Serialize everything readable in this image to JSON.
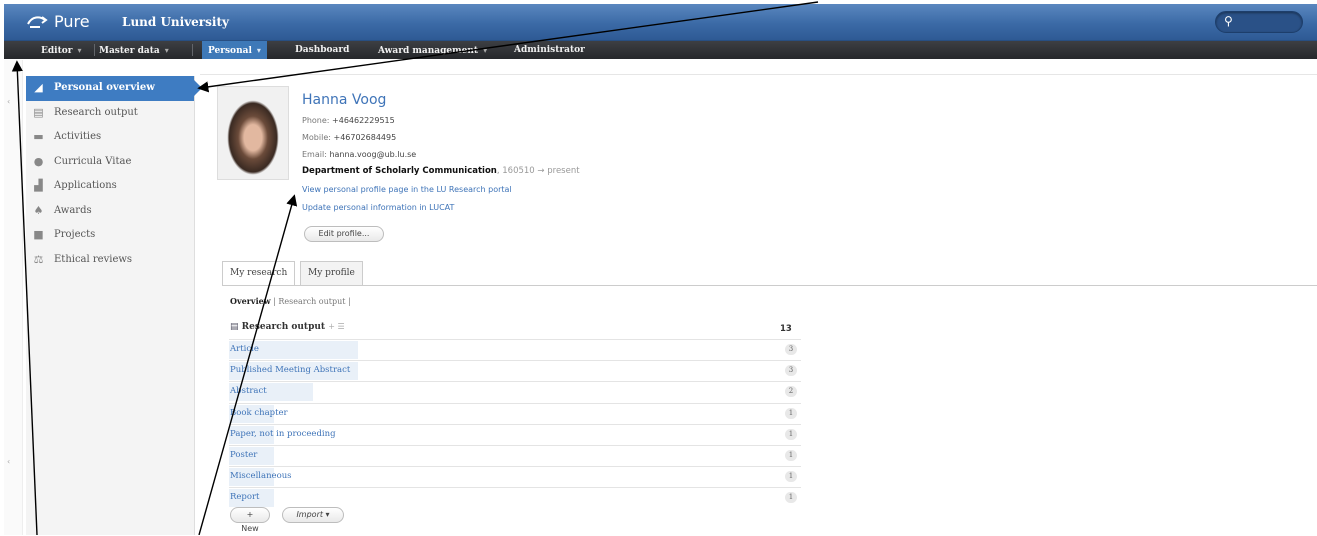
{
  "header": {
    "app_name": "Pure",
    "institution": "Lund University",
    "search_placeholder": ""
  },
  "nav": {
    "items": [
      {
        "label": "Editor",
        "has_menu": true
      },
      {
        "label": "Master data",
        "has_menu": true
      },
      {
        "label": "Personal",
        "has_menu": true,
        "active": true
      },
      {
        "label": "Dashboard",
        "has_menu": false
      },
      {
        "label": "Award management",
        "has_menu": true
      },
      {
        "label": "Administrator",
        "has_menu": false
      }
    ],
    "menu_caret": "▾"
  },
  "sidebar": {
    "items": [
      {
        "label": "Personal overview",
        "icon": "person-icon",
        "active": true
      },
      {
        "label": "Research output",
        "icon": "book-icon"
      },
      {
        "label": "Activities",
        "icon": "briefcase-icon"
      },
      {
        "label": "Curricula Vitae",
        "icon": "globe-icon"
      },
      {
        "label": "Applications",
        "icon": "chart-icon"
      },
      {
        "label": "Awards",
        "icon": "moneybag-icon"
      },
      {
        "label": "Projects",
        "icon": "cube-icon"
      },
      {
        "label": "Ethical reviews",
        "icon": "scales-icon"
      }
    ]
  },
  "profile": {
    "name": "Hanna Voog",
    "phone_label": "Phone:",
    "phone": "+46462229515",
    "mobile_label": "Mobile:",
    "mobile": "+46702684495",
    "email_label": "Email:",
    "email": "hanna.voog@ub.lu.se",
    "department": "Department of Scholarly Communication",
    "department_dates": ", 160510 → present",
    "link_portal": "View personal profile page in the LU Research portal",
    "link_lucat": "Update personal information in LUCAT",
    "edit_button": "Edit profile..."
  },
  "tabs": [
    {
      "label": "My research",
      "active": true
    },
    {
      "label": "My profile",
      "active": false
    }
  ],
  "subnav": {
    "current": "Overview",
    "sep": "|",
    "other": "Research output",
    "sep2": "|"
  },
  "research_output": {
    "title": "Research output",
    "more": "+ ☰",
    "total": "13",
    "rows": [
      {
        "label": "Article",
        "count": "3",
        "fraction": 0.23
      },
      {
        "label": "Published Meeting Abstract",
        "count": "3",
        "fraction": 0.23
      },
      {
        "label": "Abstract",
        "count": "2",
        "fraction": 0.15
      },
      {
        "label": "Book chapter",
        "count": "1",
        "fraction": 0.08
      },
      {
        "label": "Paper, not in proceeding",
        "count": "1",
        "fraction": 0.08
      },
      {
        "label": "Poster",
        "count": "1",
        "fraction": 0.08
      },
      {
        "label": "Miscellaneous",
        "count": "1",
        "fraction": 0.08
      },
      {
        "label": "Report",
        "count": "1",
        "fraction": 0.08
      }
    ],
    "new_button": "+ New",
    "import_button": "Import ▾"
  },
  "colors": {
    "header_blue": "#3b6aa6",
    "nav_dark": "#2b2d30",
    "active_blue": "#3e7cc2",
    "link_blue": "#3f74b8"
  }
}
